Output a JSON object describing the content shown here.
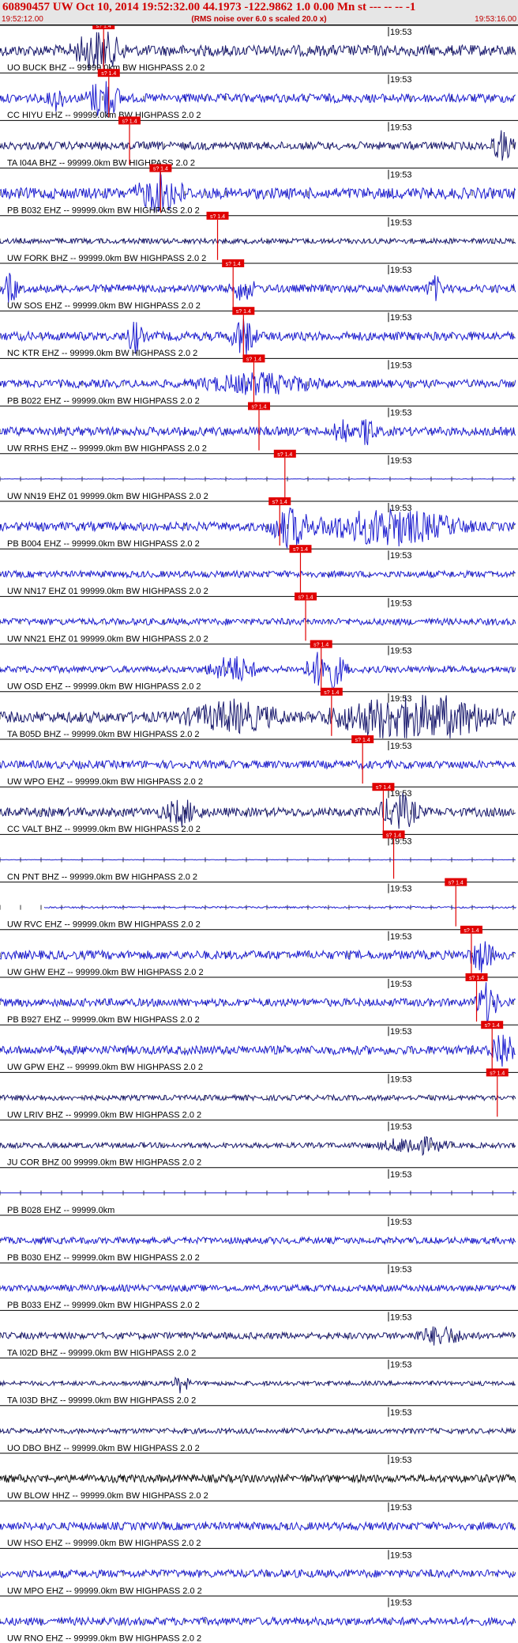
{
  "header": {
    "title": "60890457 UW Oct 10, 2014 19:52:32.00   44.1973 -122.9862  1.0 0.00 Mn st --- -- --  -1",
    "start_time": "19:52:12.00",
    "note": "(RMS noise over 6.0 s scaled 20.0 x)",
    "end_time": "19:53:16.00"
  },
  "minute_mark": "19:53",
  "pick_label": "s? 1.4",
  "traces": [
    {
      "label": "UO BUCK BHZ -- 99999.0km BW  HIGHPASS  2.0  2",
      "color": "#1a1a6e",
      "amp": 0.25,
      "pick": 0.2,
      "events": [
        [
          0.19,
          0.9,
          0.06
        ]
      ]
    },
    {
      "label": "CC HIYU EHZ -- 99999.0km BW  HIGHPASS  2.0  2",
      "color": "#1f1fd0",
      "amp": 0.2,
      "pick": 0.21,
      "events": [
        [
          0.11,
          0.5,
          0.02
        ],
        [
          0.2,
          1.0,
          0.04
        ]
      ]
    },
    {
      "label": "TA I04A BHZ -- 99999.0km BW  HIGHPASS  2.0  2",
      "color": "#1a1a6e",
      "amp": 0.18,
      "pick": 0.25,
      "events": [
        [
          0.97,
          0.6,
          0.03
        ]
      ]
    },
    {
      "label": "PB B032 EHZ -- 99999.0km BW  HIGHPASS  2.0  2",
      "color": "#1f1fd0",
      "amp": 0.25,
      "pick": 0.31,
      "events": [
        [
          0.31,
          0.8,
          0.06
        ]
      ]
    },
    {
      "label": "UW FORK BHZ -- 99999.0km BW  HIGHPASS  2.0  2",
      "color": "#1a1a6e",
      "amp": 0.12,
      "pick": 0.42,
      "events": []
    },
    {
      "label": "UW SOS EHZ -- 99999.0km BW  HIGHPASS  2.0  2",
      "color": "#1f1fd0",
      "amp": 0.18,
      "pick": 0.45,
      "events": [
        [
          0.02,
          0.6,
          0.02
        ],
        [
          0.47,
          0.5,
          0.03
        ],
        [
          0.84,
          0.5,
          0.02
        ]
      ]
    },
    {
      "label": "NC KTR EHZ -- 99999.0km BW  HIGHPASS  2.0  2",
      "color": "#1f1fd0",
      "amp": 0.2,
      "pick": 0.47,
      "events": [
        [
          0.26,
          0.7,
          0.02
        ],
        [
          0.47,
          0.9,
          0.03
        ]
      ]
    },
    {
      "label": "PB B022 EHZ -- 99999.0km BW  HIGHPASS  2.0  2",
      "color": "#1f1fd0",
      "amp": 0.18,
      "pick": 0.49,
      "events": [
        [
          0.5,
          0.4,
          0.15
        ]
      ]
    },
    {
      "label": "UW RRHS EHZ -- 99999.0km BW  HIGHPASS  2.0  2",
      "color": "#1f1fd0",
      "amp": 0.2,
      "pick": 0.5,
      "events": [
        [
          0.66,
          0.6,
          0.02
        ],
        [
          0.71,
          0.7,
          0.02
        ]
      ]
    },
    {
      "label": "UW NN19 EHZ 01 99999.0km BW  HIGHPASS  2.0  2",
      "color": "#1f1fd0",
      "amp": 0.01,
      "pick": 0.55,
      "events": []
    },
    {
      "label": "PB B004 EHZ -- 99999.0km BW  HIGHPASS  2.0  2",
      "color": "#1f1fd0",
      "amp": 0.2,
      "pick": 0.54,
      "events": [
        [
          0.56,
          0.9,
          0.05
        ],
        [
          0.75,
          0.8,
          0.18
        ]
      ]
    },
    {
      "label": "UW NN17 EHZ 01 99999.0km BW  HIGHPASS  2.0  2",
      "color": "#1f1fd0",
      "amp": 0.15,
      "pick": 0.58,
      "events": []
    },
    {
      "label": "UW NN21 EHZ 01 99999.0km BW  HIGHPASS  2.0  2",
      "color": "#1f1fd0",
      "amp": 0.15,
      "pick": 0.59,
      "events": []
    },
    {
      "label": "UW OSD EHZ -- 99999.0km BW  HIGHPASS  2.0  2",
      "color": "#1f1fd0",
      "amp": 0.15,
      "pick": 0.62,
      "events": [
        [
          0.45,
          0.6,
          0.06
        ],
        [
          0.63,
          1.0,
          0.05
        ]
      ]
    },
    {
      "label": "TA B05D BHZ -- 99999.0km BW  HIGHPASS  2.0  2",
      "color": "#1a1a6e",
      "amp": 0.25,
      "pick": 0.64,
      "events": [
        [
          0.45,
          0.6,
          0.12
        ],
        [
          0.8,
          1.1,
          0.2
        ]
      ]
    },
    {
      "label": "UW WPO EHZ -- 99999.0km BW  HIGHPASS  2.0  2",
      "color": "#1f1fd0",
      "amp": 0.18,
      "pick": 0.7,
      "events": []
    },
    {
      "label": "CC VALT BHZ -- 99999.0km BW  HIGHPASS  2.0  2",
      "color": "#1a1a6e",
      "amp": 0.2,
      "pick": 0.74,
      "events": [
        [
          0.35,
          0.5,
          0.05
        ],
        [
          0.77,
          0.8,
          0.05
        ]
      ]
    },
    {
      "label": "CN PNT BHZ -- 99999.0km BW  HIGHPASS  2.0  2",
      "color": "#1f1fd0",
      "amp": 0.01,
      "pick": 0.76,
      "events": []
    },
    {
      "label": "UW RVC EHZ -- 99999.0km BW  HIGHPASS  2.0  2",
      "color": "#1f1fd0",
      "amp": 0.04,
      "pick": 0.88,
      "events": []
    },
    {
      "label": "UW GHW EHZ -- 99999.0km BW  HIGHPASS  2.0  2",
      "color": "#1f1fd0",
      "amp": 0.2,
      "pick": 0.91,
      "events": [
        [
          0.93,
          0.7,
          0.03
        ]
      ]
    },
    {
      "label": "PB B927 EHZ -- 99999.0km BW  HIGHPASS  2.0  2",
      "color": "#1f1fd0",
      "amp": 0.18,
      "pick": 0.92,
      "events": [
        [
          0.94,
          0.8,
          0.03
        ]
      ]
    },
    {
      "label": "UW GPW EHZ -- 99999.0km BW  HIGHPASS  2.0  2",
      "color": "#1f1fd0",
      "amp": 0.2,
      "pick": 0.95,
      "events": [
        [
          0.97,
          1.0,
          0.03
        ]
      ]
    },
    {
      "label": "UW LRIV BHZ -- 99999.0km BW  HIGHPASS  2.0  2",
      "color": "#1a1a6e",
      "amp": 0.12,
      "pick": 0.96,
      "events": []
    },
    {
      "label": "JU COR BHZ 00 99999.0km BW  HIGHPASS  2.0  2",
      "color": "#1a1a6e",
      "amp": 0.12,
      "pick": null,
      "events": [
        [
          0.8,
          0.4,
          0.08
        ]
      ]
    },
    {
      "label": "PB B028 EHZ -- 99999.0km",
      "color": "#1f1fd0",
      "amp": 0.0,
      "pick": null,
      "events": []
    },
    {
      "label": "PB B030 EHZ -- 99999.0km BW  HIGHPASS  2.0  2",
      "color": "#1f1fd0",
      "amp": 0.15,
      "pick": null,
      "events": []
    },
    {
      "label": "PB B033 EHZ -- 99999.0km BW  HIGHPASS  2.0  2",
      "color": "#1f1fd0",
      "amp": 0.15,
      "pick": null,
      "events": []
    },
    {
      "label": "TA I02D BHZ -- 99999.0km BW  HIGHPASS  2.0  2",
      "color": "#1a1a6e",
      "amp": 0.15,
      "pick": null,
      "events": [
        [
          0.85,
          0.4,
          0.06
        ]
      ]
    },
    {
      "label": "TA I03D BHZ -- 99999.0km BW  HIGHPASS  2.0  2",
      "color": "#1a1a6e",
      "amp": 0.1,
      "pick": null,
      "events": [
        [
          0.35,
          0.4,
          0.02
        ]
      ]
    },
    {
      "label": "UO DBO BHZ -- 99999.0km BW  HIGHPASS  2.0  2",
      "color": "#1a1a6e",
      "amp": 0.12,
      "pick": null,
      "events": []
    },
    {
      "label": "UW BLOW HHZ -- 99999.0km BW  HIGHPASS  2.0  2",
      "color": "#111111",
      "amp": 0.18,
      "pick": null,
      "events": []
    },
    {
      "label": "UW HSO EHZ -- 99999.0km BW  HIGHPASS  2.0  2",
      "color": "#1f1fd0",
      "amp": 0.18,
      "pick": null,
      "events": []
    },
    {
      "label": "UW MPO EHZ -- 99999.0km BW  HIGHPASS  2.0  2",
      "color": "#1f1fd0",
      "amp": 0.18,
      "pick": null,
      "events": []
    },
    {
      "label": "UW RNO EHZ -- 99999.0km BW  HIGHPASS  2.0  2",
      "color": "#1f1fd0",
      "amp": 0.18,
      "pick": null,
      "events": []
    }
  ]
}
